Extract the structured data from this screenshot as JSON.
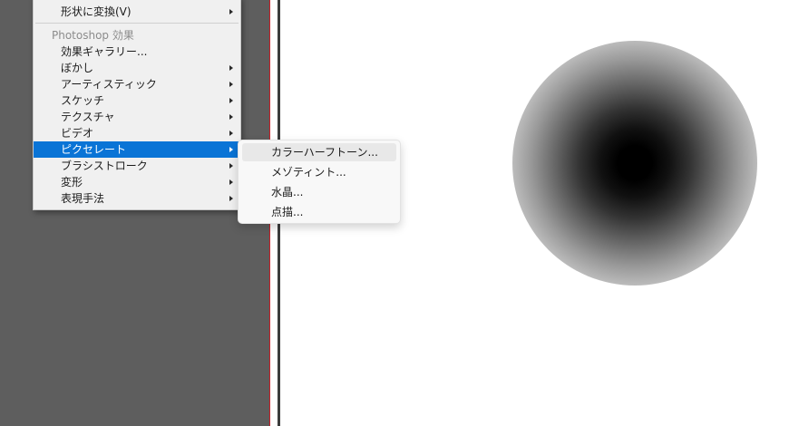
{
  "context_menu": {
    "items": [
      {
        "label": "形状に変換(V)",
        "has_submenu": true
      },
      {
        "label": "効果ギャラリー...",
        "has_submenu": false
      },
      {
        "label": "ぼかし",
        "has_submenu": true
      },
      {
        "label": "アーティスティック",
        "has_submenu": true
      },
      {
        "label": "スケッチ",
        "has_submenu": true
      },
      {
        "label": "テクスチャ",
        "has_submenu": true
      },
      {
        "label": "ビデオ",
        "has_submenu": true
      },
      {
        "label": "ピクセレート",
        "has_submenu": true,
        "selected": true
      },
      {
        "label": "ブラシストローク",
        "has_submenu": true
      },
      {
        "label": "変形",
        "has_submenu": true
      },
      {
        "label": "表現手法",
        "has_submenu": true
      }
    ],
    "section_header": "Photoshop 効果"
  },
  "submenu": {
    "items": [
      {
        "label": "カラーハーフトーン..."
      },
      {
        "label": "メゾティント..."
      },
      {
        "label": "水晶..."
      },
      {
        "label": "点描..."
      }
    ]
  },
  "colors": {
    "selection": "#0a74d6",
    "workspace": "#5e5e5e",
    "guide": "#c8202a"
  }
}
